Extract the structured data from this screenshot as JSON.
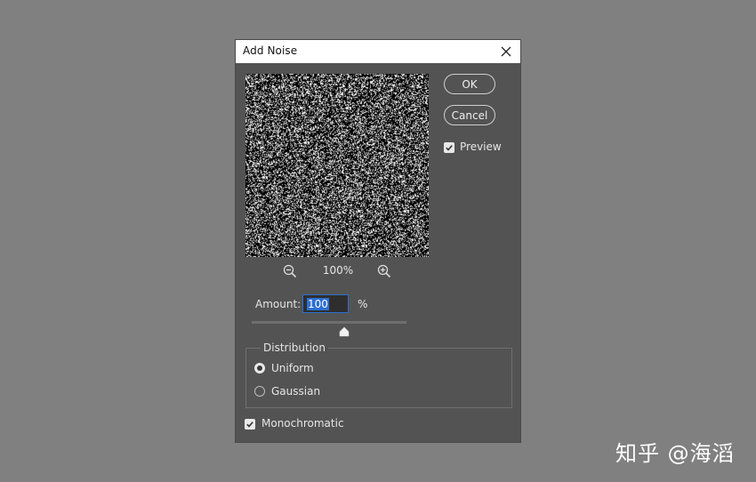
{
  "dialog": {
    "title": "Add Noise",
    "close_icon": "close-icon"
  },
  "preview": {
    "zoom_level": "100%",
    "zoom_out_icon": "zoom-out-icon",
    "zoom_in_icon": "zoom-in-icon"
  },
  "buttons": {
    "ok_label": "OK",
    "cancel_label": "Cancel"
  },
  "preview_toggle": {
    "label": "Preview",
    "checked": true
  },
  "amount": {
    "label": "Amount:",
    "value": "100",
    "unit": "%",
    "slider_fraction": 0.6
  },
  "distribution": {
    "legend": "Distribution",
    "options": [
      {
        "label": "Uniform",
        "selected": true
      },
      {
        "label": "Gaussian",
        "selected": false
      }
    ]
  },
  "monochromatic": {
    "label": "Monochromatic",
    "checked": true
  },
  "watermark": {
    "text": "知乎 @海滔"
  },
  "colors": {
    "canvas_bg": "#808080",
    "dialog_bg": "#535353",
    "titlebar_bg": "#ffffff",
    "selection_blue": "#2d6fd1"
  }
}
